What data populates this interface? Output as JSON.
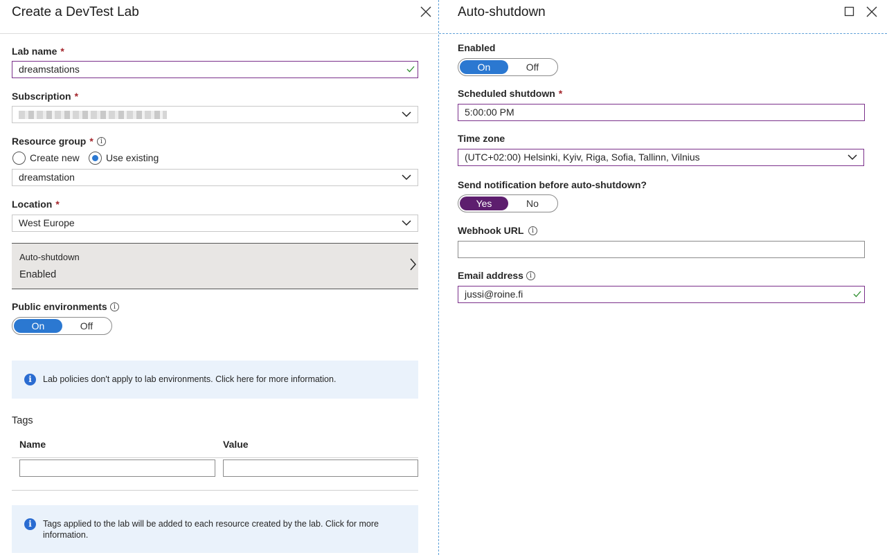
{
  "left_blade": {
    "title": "Create a DevTest Lab",
    "lab_name": {
      "label": "Lab name",
      "required": "*",
      "value": "dreamstations"
    },
    "subscription": {
      "label": "Subscription",
      "required": "*",
      "value": ""
    },
    "resource_group": {
      "label": "Resource group",
      "required": "*",
      "options": [
        "Create new",
        "Use existing"
      ],
      "selected": "Use existing",
      "value": "dreamstation"
    },
    "location": {
      "label": "Location",
      "required": "*",
      "value": "West Europe"
    },
    "auto_shutdown_tile": {
      "label": "Auto-shutdown",
      "value": "Enabled"
    },
    "public_environments": {
      "label": "Public environments",
      "on_label": "On",
      "off_label": "Off",
      "selected": "On"
    },
    "env_info": "Lab policies don't apply to lab environments.  Click here for more information.",
    "tags": {
      "title": "Tags",
      "columns": [
        "Name",
        "Value"
      ],
      "rows": [
        {
          "name": "",
          "value": ""
        }
      ],
      "info": "Tags applied to the lab will be added to each resource created by the lab.  Click for more information."
    }
  },
  "right_blade": {
    "title": "Auto-shutdown",
    "enabled": {
      "label": "Enabled",
      "on_label": "On",
      "off_label": "Off",
      "selected": "On"
    },
    "scheduled_shutdown": {
      "label": "Scheduled shutdown",
      "required": "*",
      "value": "5:00:00 PM"
    },
    "time_zone": {
      "label": "Time zone",
      "value": "(UTC+02:00) Helsinki, Kyiv, Riga, Sofia, Tallinn, Vilnius"
    },
    "send_notification": {
      "label": "Send notification before auto-shutdown?",
      "yes_label": "Yes",
      "no_label": "No",
      "selected": "Yes"
    },
    "webhook_url": {
      "label": "Webhook URL",
      "value": ""
    },
    "email_address": {
      "label": "Email address",
      "value": "jussi@roine.fi"
    }
  },
  "icons": {
    "close": "close-icon",
    "maximize": "maximize-icon",
    "chevron_down": "chevron-down-icon",
    "chevron_right": "chevron-right-icon",
    "info": "info-icon",
    "check": "checkmark-icon"
  },
  "colors": {
    "toggle_on": "#2b78d1",
    "toggle_yes": "#5d1e6e",
    "focus_border": "#7a2f8a",
    "required": "#a4262c",
    "info_bg": "#eaf2fb",
    "tile_bg": "#e8e6e4"
  }
}
